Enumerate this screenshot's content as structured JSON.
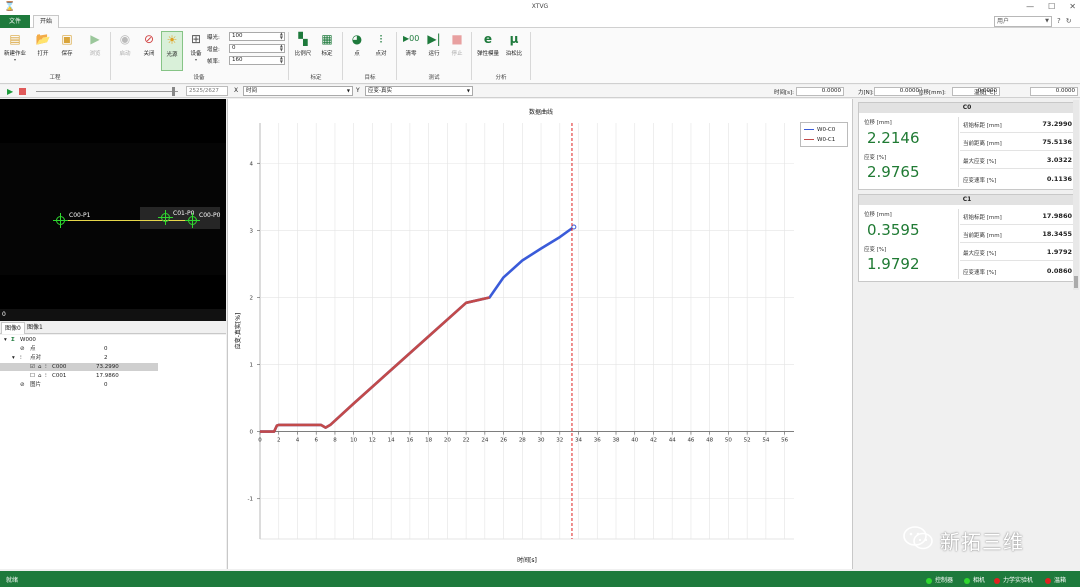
{
  "window": {
    "title": "XTVG"
  },
  "menu": {
    "tabs": [
      {
        "label": "文件"
      },
      {
        "label": "开始"
      }
    ],
    "user_placeholder": "用户",
    "icons": [
      "help-icon",
      "refresh-icon"
    ]
  },
  "ribbon": {
    "groups": [
      {
        "label": "工程",
        "buttons": [
          {
            "label": "新建作业",
            "icon": "new-job-icon"
          },
          {
            "label": "打开",
            "icon": "open-icon"
          },
          {
            "label": "保存",
            "icon": "save-icon"
          },
          {
            "label": "浏览",
            "icon": "browse-icon",
            "disabled": true
          }
        ]
      },
      {
        "label": "设备",
        "buttons": [
          {
            "label": "启动",
            "icon": "eye-icon",
            "disabled": true
          },
          {
            "label": "关闭",
            "icon": "camera-off-icon"
          },
          {
            "label": "光源",
            "icon": "light-icon",
            "active": true
          },
          {
            "label": "设备",
            "icon": "device-icon"
          }
        ]
      },
      {
        "label": "标定",
        "buttons": [
          {
            "label": "比例尺",
            "icon": "ruler-icon"
          },
          {
            "label": "标定",
            "icon": "calibrate-icon"
          }
        ]
      },
      {
        "label": "目标",
        "buttons": [
          {
            "label": "点",
            "icon": "point-icon"
          },
          {
            "label": "点对",
            "icon": "point-pair-icon"
          }
        ]
      },
      {
        "label": "测试",
        "buttons": [
          {
            "label": "清零",
            "icon": "zero-icon"
          },
          {
            "label": "运行",
            "icon": "run-icon"
          },
          {
            "label": "停止",
            "icon": "stop-icon",
            "disabled": true
          }
        ]
      },
      {
        "label": "分析",
        "buttons": [
          {
            "label": "弹性模量",
            "icon": "elastic-modulus-icon"
          },
          {
            "label": "泊松比",
            "icon": "poisson-ratio-icon"
          }
        ]
      }
    ],
    "camera": {
      "exposure": {
        "label": "曝光:",
        "value": "100"
      },
      "gain": {
        "label": "增益:",
        "value": "0"
      },
      "frame_rate": {
        "label": "帧率:",
        "value": "160"
      }
    }
  },
  "toolbar2": {
    "frame_counter": "2525/2627",
    "x_axis": {
      "label": "X",
      "value": "时间"
    },
    "y_axis": {
      "label": "Y",
      "value": "应变-真实"
    },
    "readouts": [
      {
        "label": "时间[s]:",
        "value": "0.0000"
      },
      {
        "label": "力[N]:",
        "value": "0.0000"
      },
      {
        "label": "位移[mm]:",
        "value": "0.0000"
      },
      {
        "label": "温度[℃]:",
        "value": "0.0000"
      }
    ]
  },
  "video": {
    "points": [
      {
        "label": "C00-P1"
      },
      {
        "label": "C01-P0"
      },
      {
        "label": "C00-P0"
      }
    ],
    "scroll_value": "0"
  },
  "image_tabs": [
    {
      "label": "图像0"
    },
    {
      "label": "图像1"
    }
  ],
  "tree": {
    "root": "W000",
    "rows": [
      {
        "name": "点",
        "value": "0"
      },
      {
        "name": "点对",
        "value": "2"
      },
      {
        "name": "C000",
        "value": "73.2990"
      },
      {
        "name": "C001",
        "value": "17.9860"
      },
      {
        "name": "图片",
        "value": "0"
      }
    ]
  },
  "chart_data": {
    "type": "line",
    "title": "数据曲线",
    "xlabel": "时间[s]",
    "ylabel": "应变-真实[%]",
    "xlim": [
      0,
      57
    ],
    "ylim": [
      -1.6,
      4.6
    ],
    "xticks": [
      0,
      2,
      4,
      6,
      8,
      10,
      12,
      14,
      16,
      18,
      20,
      22,
      24,
      26,
      28,
      30,
      32,
      34,
      36,
      38,
      40,
      42,
      44,
      46,
      48,
      50,
      52,
      54,
      56
    ],
    "yticks": [
      -1,
      0,
      1,
      2,
      3,
      4
    ],
    "grid": true,
    "legend_position": "top-right",
    "vline": {
      "x": 33.3,
      "color": "#e02020"
    },
    "series": [
      {
        "name": "W0-C0",
        "color": "#3a5bd9",
        "x": [
          0,
          1.5,
          1.8,
          2.0,
          6.5,
          7.0,
          7.5,
          10,
          14,
          18,
          22,
          24.5,
          26,
          28,
          30,
          32,
          33.5
        ],
        "y": [
          0,
          0,
          0.09,
          0.1,
          0.1,
          0.06,
          0.1,
          0.42,
          0.92,
          1.42,
          1.92,
          2.0,
          2.3,
          2.55,
          2.73,
          2.9,
          3.05
        ]
      },
      {
        "name": "W0-C1",
        "color": "#c24a4a",
        "x": [
          0,
          1.5,
          1.8,
          2.0,
          6.5,
          7.0,
          7.5,
          10,
          14,
          18,
          22,
          24.5
        ],
        "y": [
          0,
          0,
          0.09,
          0.1,
          0.1,
          0.06,
          0.1,
          0.42,
          0.92,
          1.42,
          1.92,
          2.0
        ]
      }
    ]
  },
  "results": [
    {
      "name": "C0",
      "displacement": {
        "label": "位移 [mm]",
        "value": "2.2146"
      },
      "strain": {
        "label": "应变 [%]",
        "value": "2.9765"
      },
      "rows": [
        {
          "label": "初始标距 [mm]",
          "value": "73.2990"
        },
        {
          "label": "当前距离 [mm]",
          "value": "75.5136"
        },
        {
          "label": "最大应变 [%]",
          "value": "3.0322"
        },
        {
          "label": "应变速率 [%]",
          "value": "0.1136"
        }
      ]
    },
    {
      "name": "C1",
      "displacement": {
        "label": "位移 [mm]",
        "value": "0.3595"
      },
      "strain": {
        "label": "应变 [%]",
        "value": "1.9792"
      },
      "rows": [
        {
          "label": "初始标距 [mm]",
          "value": "17.9860"
        },
        {
          "label": "当前距离 [mm]",
          "value": "18.3455"
        },
        {
          "label": "最大应变 [%]",
          "value": "1.9792"
        },
        {
          "label": "应变速率 [%]",
          "value": "0.0860"
        }
      ]
    }
  ],
  "status": {
    "ready": "就绪",
    "indicators": [
      {
        "label": "控制器",
        "color": "#2fd82f"
      },
      {
        "label": "相机",
        "color": "#2fd82f"
      },
      {
        "label": "力学实验机",
        "color": "#e02020"
      },
      {
        "label": "温箱",
        "color": "#e02020"
      }
    ]
  },
  "watermark": {
    "text": "新拓三维"
  }
}
